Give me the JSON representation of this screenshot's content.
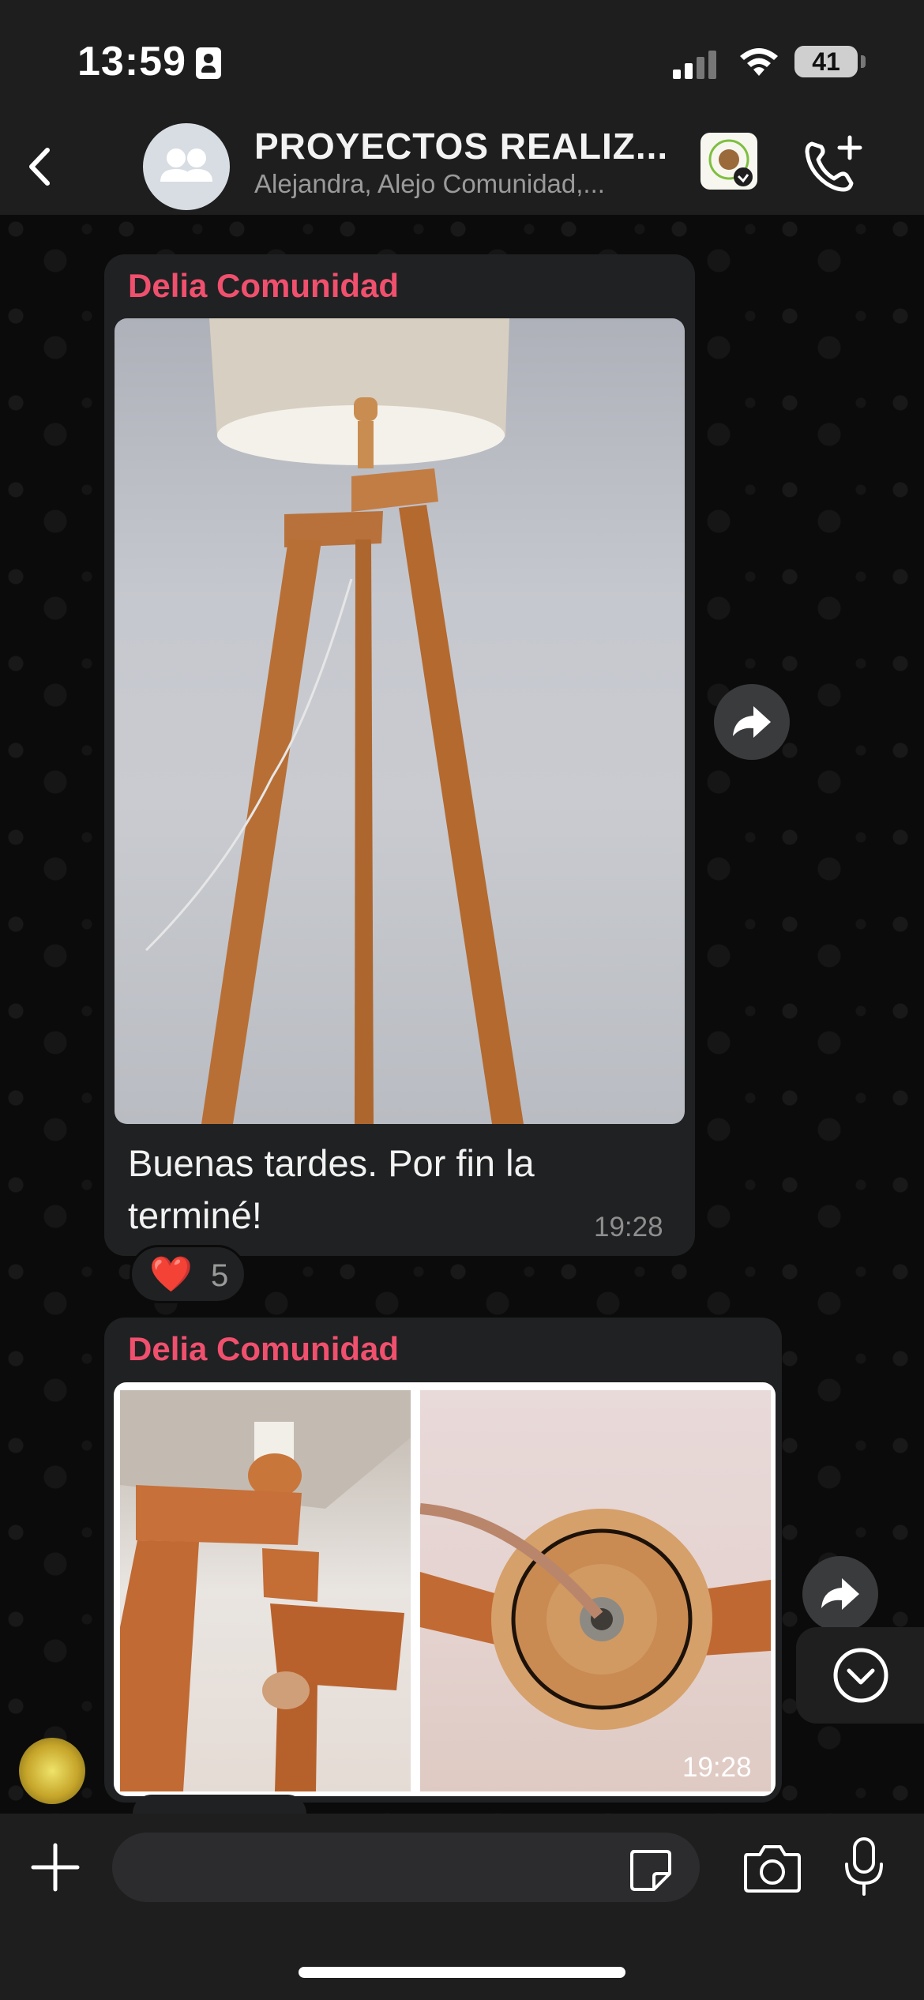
{
  "status_bar": {
    "time": "13:59",
    "battery": "41"
  },
  "header": {
    "title": "PROYECTOS REALIZ...",
    "subtitle": "Alejandra, Alejo Comunidad,..."
  },
  "messages": [
    {
      "sender": "Delia Comunidad",
      "text": "Buenas tardes. Por fin la terminé!",
      "time": "19:28",
      "reaction": {
        "emoji": "❤️",
        "count": "5"
      }
    },
    {
      "sender": "Delia Comunidad",
      "time": "19:28"
    }
  ],
  "composer": {
    "placeholder": ""
  },
  "colors": {
    "sender": "#f0506e",
    "bubble": "#202122",
    "bar": "#1e1e1e"
  },
  "icons": [
    "back-chevron-icon",
    "group-icon",
    "call-add-icon",
    "forward-icon",
    "scroll-down-icon",
    "plus-icon",
    "sticker-icon",
    "camera-icon",
    "mic-icon"
  ]
}
